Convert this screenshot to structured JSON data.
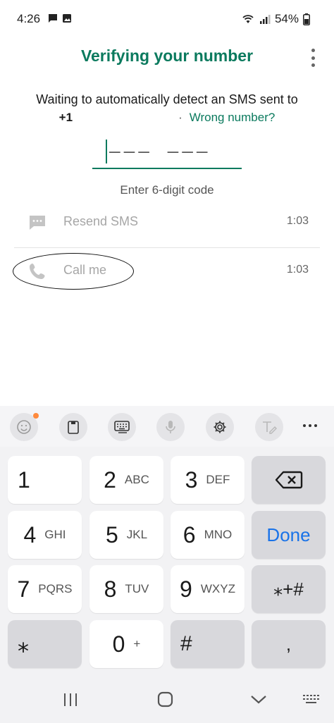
{
  "status_bar": {
    "time": "4:26",
    "battery": "54%",
    "left_icons": [
      "chat-notification-icon",
      "image-notification-icon"
    ],
    "right_icons": [
      "wifi-icon",
      "signal-icon",
      "battery-icon"
    ]
  },
  "header": {
    "title": "Verifying your number",
    "menu_icon": "more-vert-icon"
  },
  "verification": {
    "instructions": "Waiting to automatically detect an SMS sent to",
    "phone_prefix": "+1",
    "separator": "·",
    "wrong_number_link": "Wrong number?",
    "code_placeholder": "––– –––",
    "code_hint": "Enter 6-digit code"
  },
  "options": [
    {
      "label": "Resend SMS",
      "timer": "1:03",
      "icon": "message-icon"
    },
    {
      "label": "Call me",
      "timer": "1:03",
      "icon": "phone-icon"
    }
  ],
  "keyboard": {
    "toolbar_icons": [
      "emoji-icon",
      "clipboard-icon",
      "keyboard-icon",
      "microphone-icon",
      "settings-icon",
      "handwriting-icon",
      "more-horizontal-icon"
    ],
    "keys": [
      {
        "num": "1",
        "letters": ""
      },
      {
        "num": "2",
        "letters": "ABC"
      },
      {
        "num": "3",
        "letters": "DEF"
      },
      {
        "num": "4",
        "letters": "GHI"
      },
      {
        "num": "5",
        "letters": "JKL"
      },
      {
        "num": "6",
        "letters": "MNO"
      },
      {
        "num": "7",
        "letters": "PQRS"
      },
      {
        "num": "8",
        "letters": "TUV"
      },
      {
        "num": "9",
        "letters": "WXYZ"
      },
      {
        "num": "0",
        "letters": "+"
      }
    ],
    "done_label": "Done",
    "symbols_label": "⁎+#",
    "star_label": "⁎",
    "hash_label": "#",
    "comma_label": ",",
    "accent_color": "#1a73e8"
  },
  "nav_bar": {
    "icons": [
      "recents-icon",
      "home-icon",
      "back-icon",
      "keyboard-switch-icon"
    ]
  },
  "colors": {
    "brand": "#0b7a5e",
    "disabled_text": "#a6a6a6"
  }
}
